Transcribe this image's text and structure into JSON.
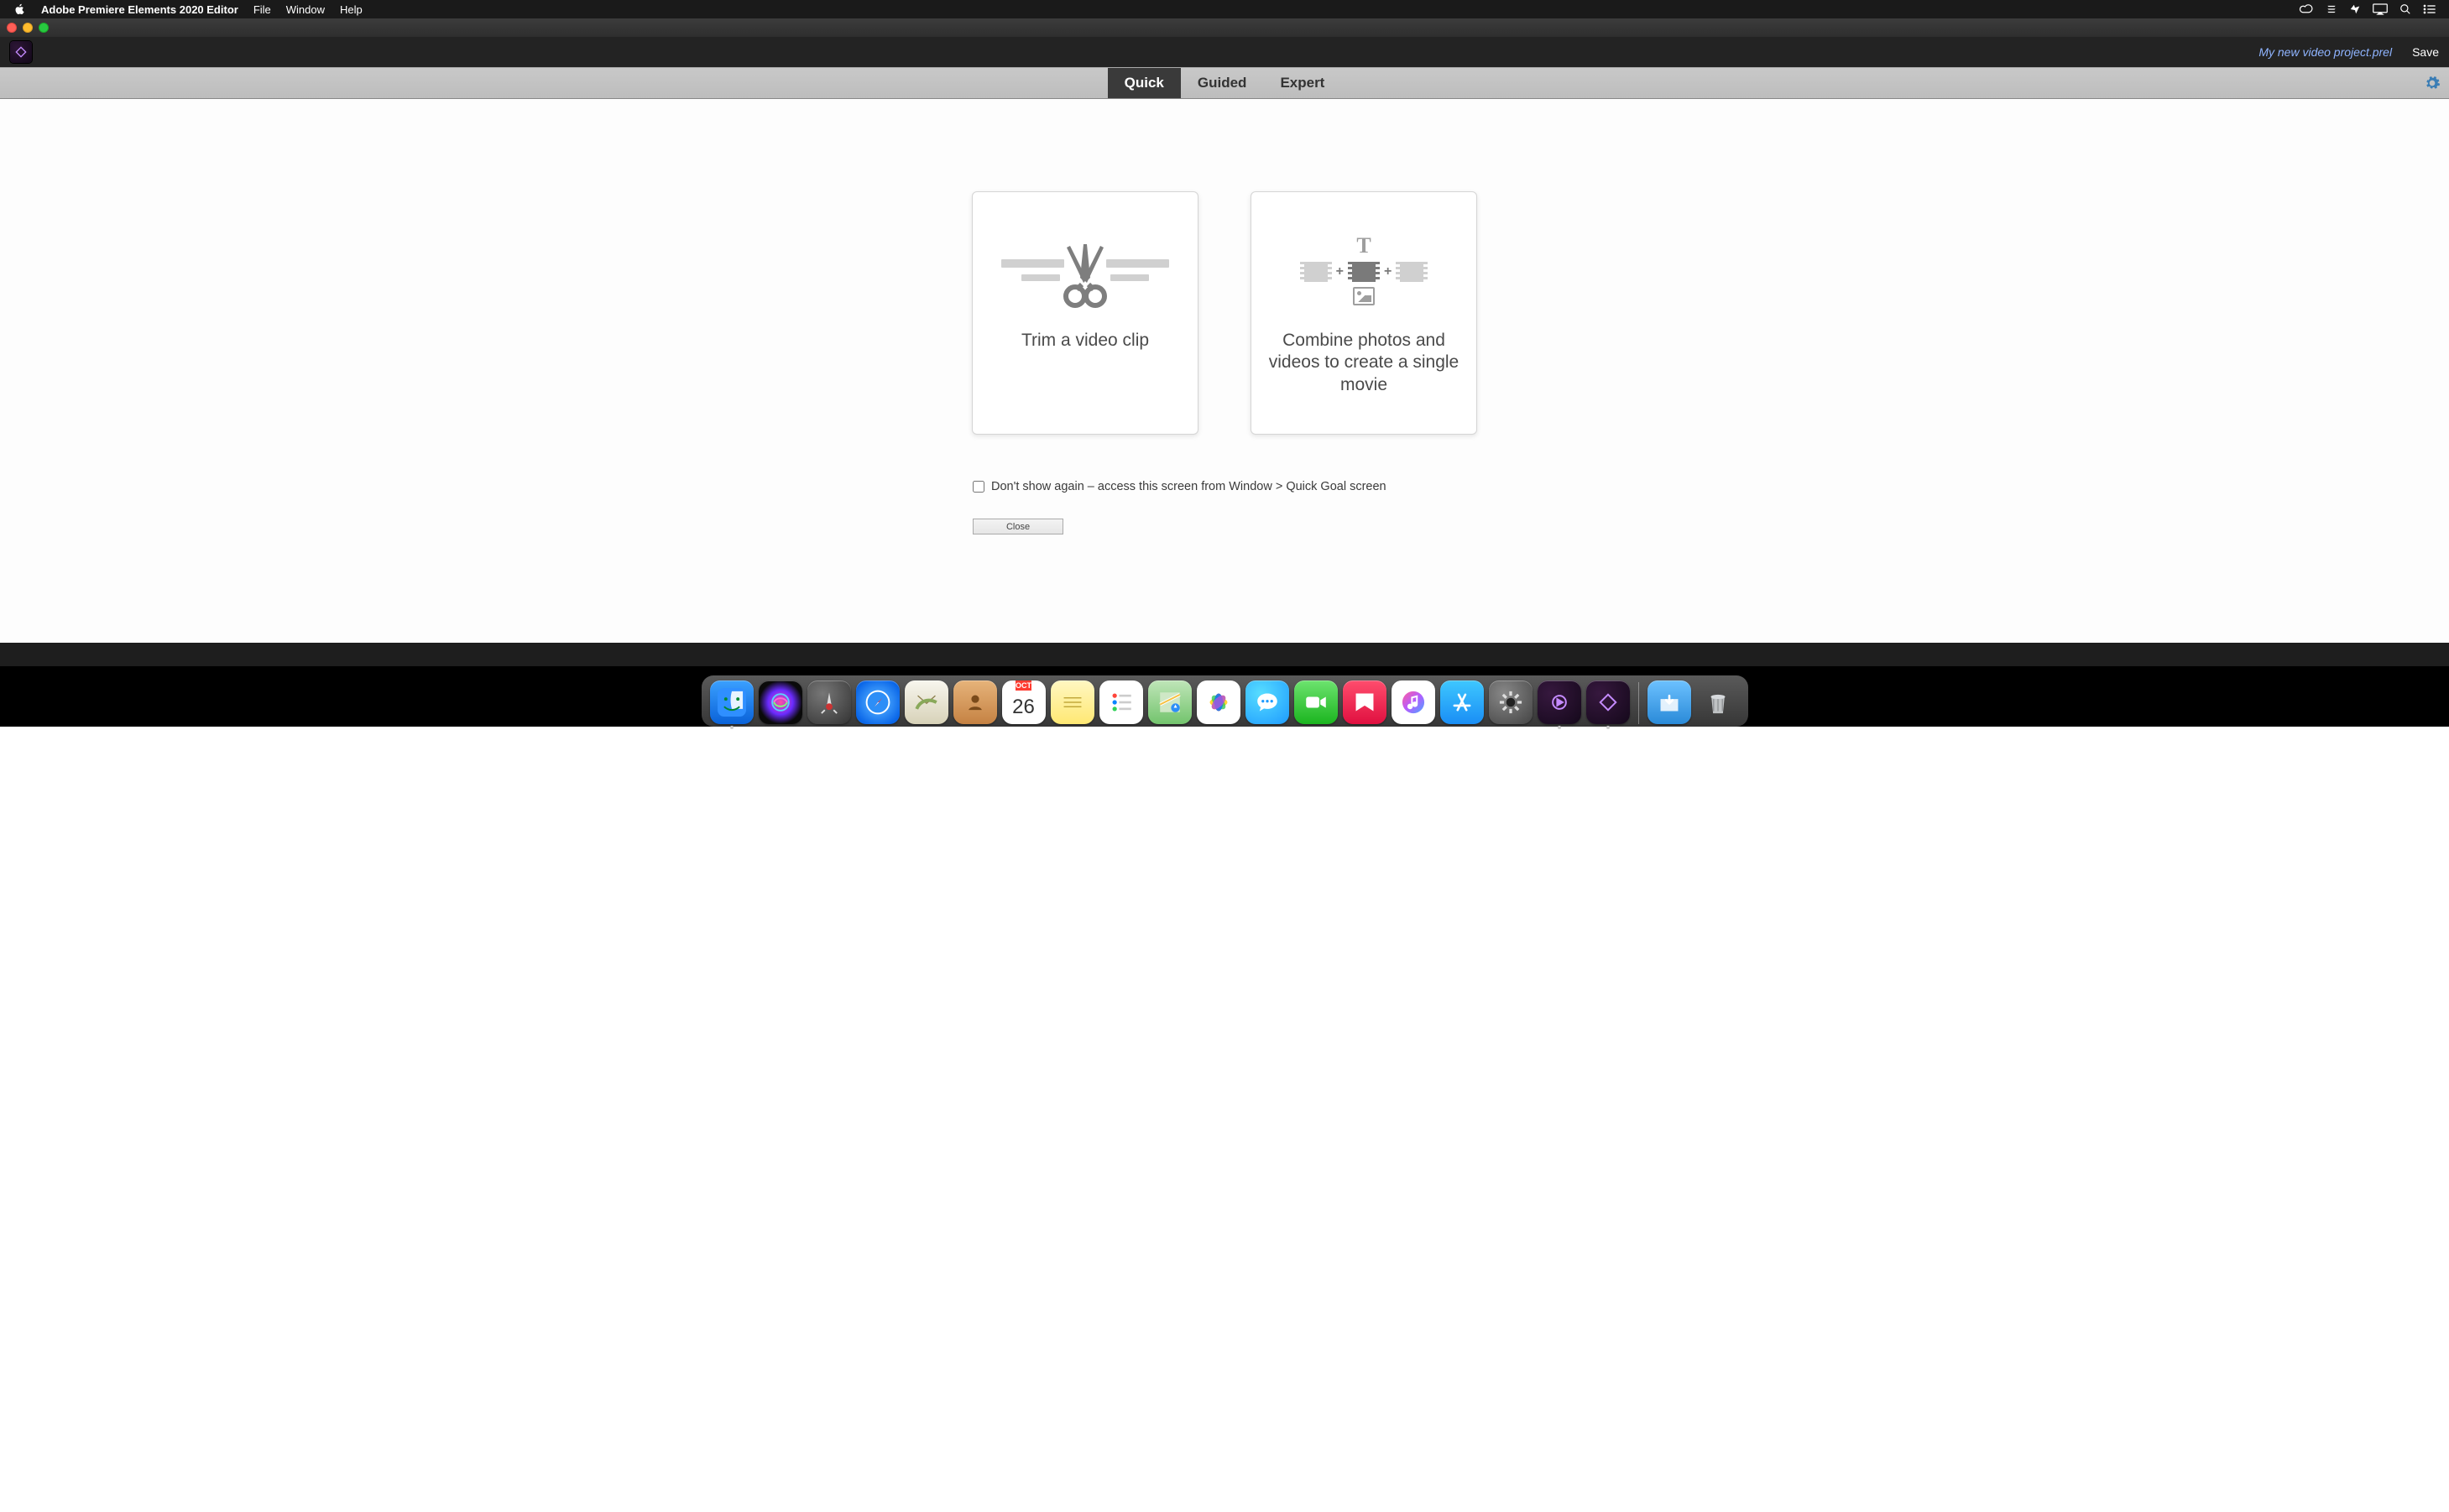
{
  "menubar": {
    "app_name": "Adobe Premiere Elements 2020 Editor",
    "items": [
      "File",
      "Window",
      "Help"
    ]
  },
  "app_header": {
    "project_name": "My new video project.prel",
    "save_label": "Save"
  },
  "mode_bar": {
    "tabs": {
      "quick": "Quick",
      "guided": "Guided",
      "expert": "Expert"
    },
    "active": "quick"
  },
  "canvas": {
    "cards": {
      "trim": {
        "label": "Trim a video clip"
      },
      "combine": {
        "label": "Combine photos and videos to create a single movie"
      }
    },
    "dont_show_label": "Don't show again – access this screen from Window > Quick Goal screen",
    "close_label": "Close"
  },
  "dock": {
    "calendar": {
      "month": "OCT",
      "day": "26"
    },
    "items": [
      {
        "id": "finder",
        "name": "Finder",
        "running": true
      },
      {
        "id": "siri",
        "name": "Siri",
        "running": false
      },
      {
        "id": "launchpad",
        "name": "Launchpad",
        "running": false
      },
      {
        "id": "safari",
        "name": "Safari",
        "running": false
      },
      {
        "id": "mail",
        "name": "Mail",
        "running": false
      },
      {
        "id": "contacts",
        "name": "Contacts",
        "running": false
      },
      {
        "id": "calendar",
        "name": "Calendar",
        "running": false
      },
      {
        "id": "notes",
        "name": "Notes",
        "running": false
      },
      {
        "id": "reminders",
        "name": "Reminders",
        "running": false
      },
      {
        "id": "maps",
        "name": "Maps",
        "running": false
      },
      {
        "id": "photos",
        "name": "Photos",
        "running": false
      },
      {
        "id": "messages",
        "name": "Messages",
        "running": false
      },
      {
        "id": "facetime",
        "name": "FaceTime",
        "running": false
      },
      {
        "id": "news",
        "name": "News",
        "running": false
      },
      {
        "id": "music",
        "name": "Music",
        "running": false
      },
      {
        "id": "appstore",
        "name": "App Store",
        "running": false
      },
      {
        "id": "settings",
        "name": "System Preferences",
        "running": false
      },
      {
        "id": "pre-alt",
        "name": "Premiere Elements",
        "running": true
      },
      {
        "id": "pre",
        "name": "Premiere Elements Editor",
        "running": true
      }
    ],
    "right_items": [
      {
        "id": "downloads",
        "name": "Downloads"
      },
      {
        "id": "trash",
        "name": "Trash"
      }
    ]
  }
}
